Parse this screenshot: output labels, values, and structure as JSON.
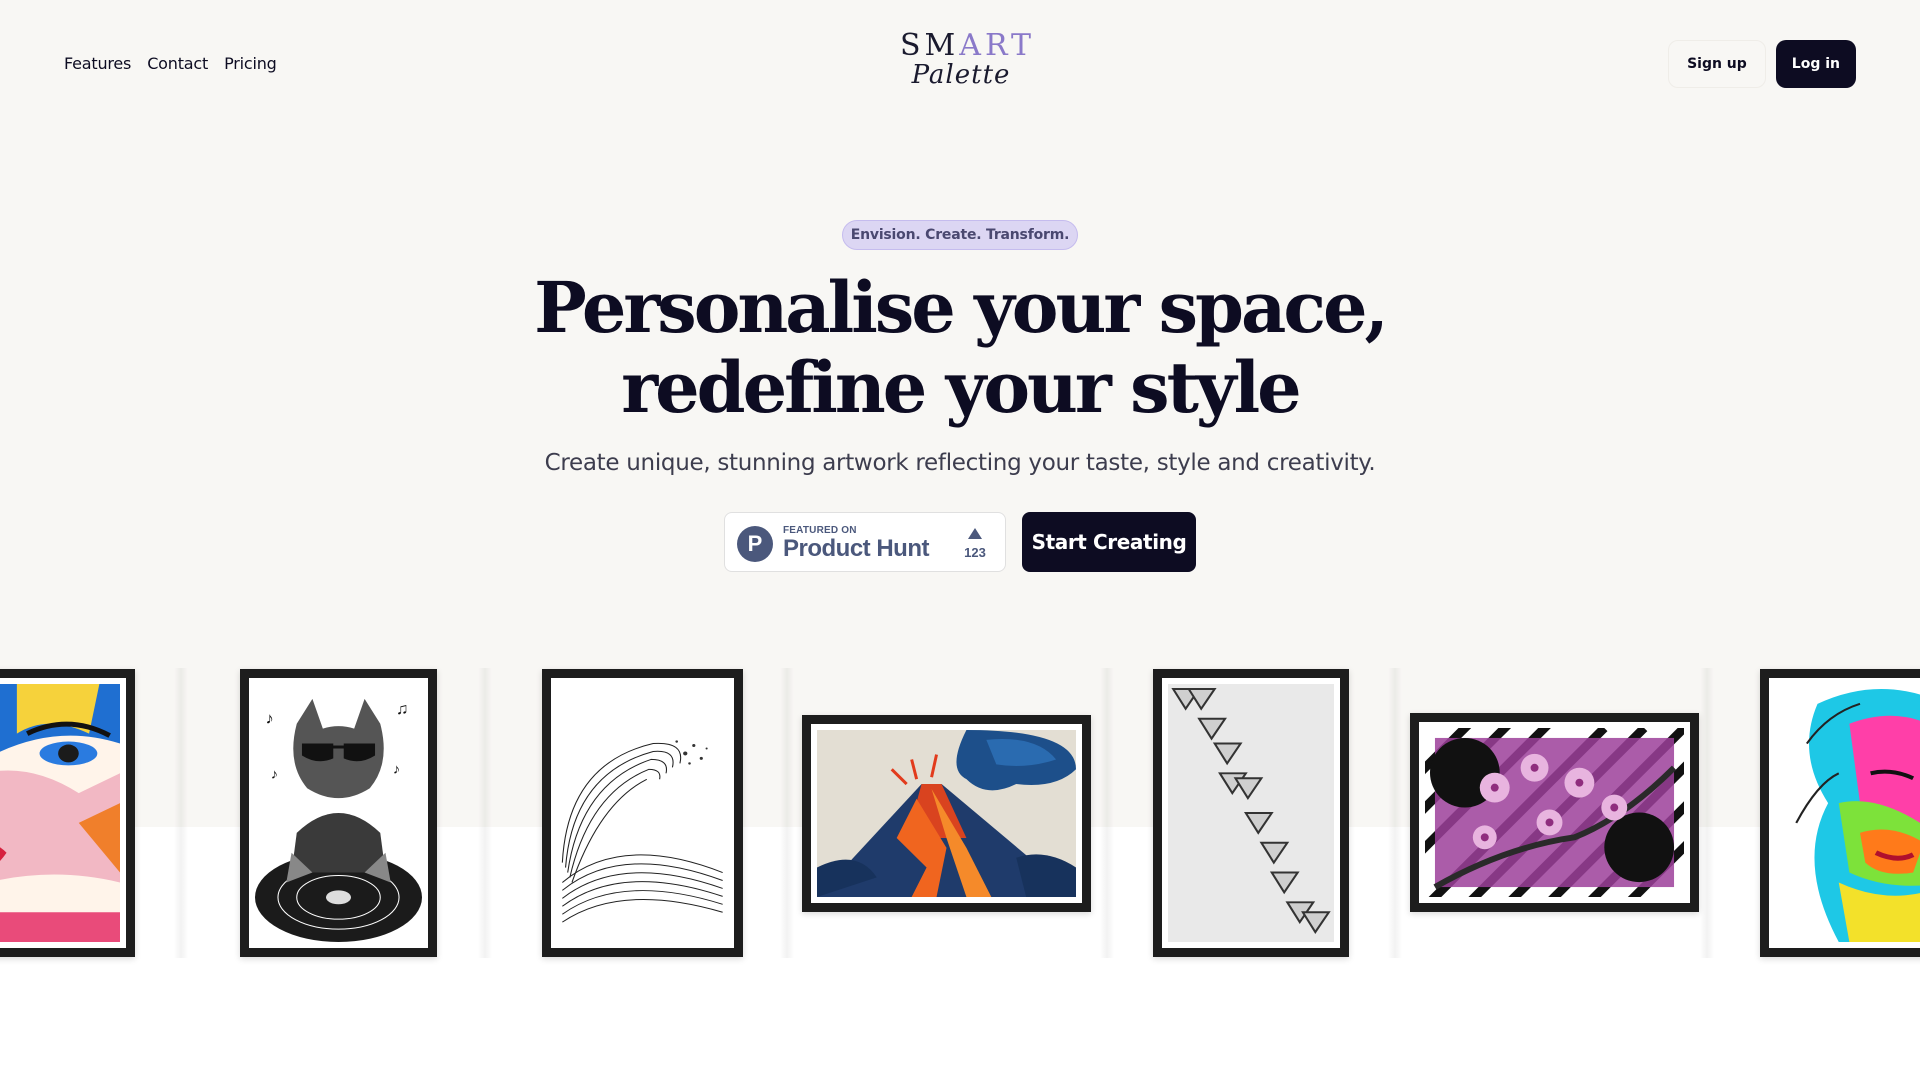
{
  "header": {
    "nav": [
      "Features",
      "Contact",
      "Pricing"
    ],
    "logo_top": "SMART",
    "logo_script": "Palette",
    "signup_label": "Sign up",
    "login_label": "Log in"
  },
  "hero": {
    "tagline": "Envision. Create. Transform.",
    "headline_line1": "Personalise your space,",
    "headline_line2": "redefine your style",
    "subhead": "Create unique, stunning artwork reflecting your taste, style and creativity.",
    "producthunt": {
      "featured": "FEATURED ON",
      "name": "Product Hunt",
      "count": "123"
    },
    "cta_label": "Start Creating"
  },
  "gallery": [
    {
      "name": "pop-art-face"
    },
    {
      "name": "dj-cat"
    },
    {
      "name": "ink-wave"
    },
    {
      "name": "volcano"
    },
    {
      "name": "diagonal-triangles"
    },
    {
      "name": "cherry-blossom"
    },
    {
      "name": "neon-face"
    }
  ],
  "colors": {
    "accent": "#8a79c9",
    "dark": "#0d0c22",
    "background": "#f8f7f4",
    "tagline_bg": "#dcd6f3",
    "producthunt": "#4b587c"
  }
}
